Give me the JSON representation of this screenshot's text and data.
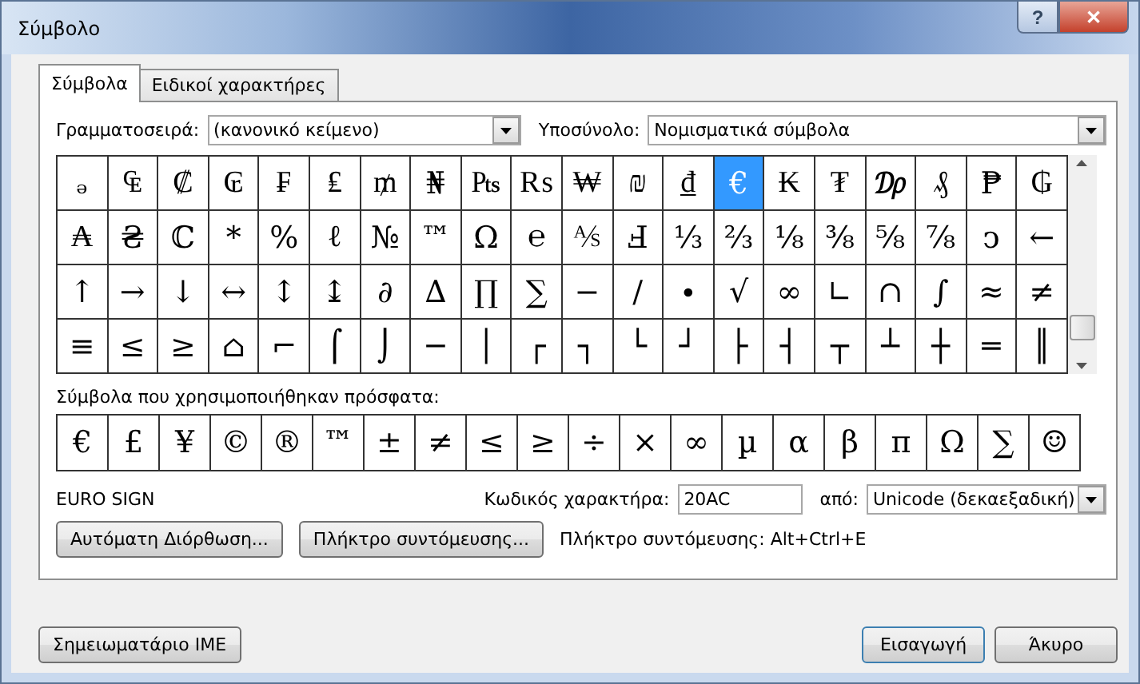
{
  "window": {
    "title": "Σύμβολο",
    "buttons": [
      "?",
      "✕"
    ]
  },
  "tabs": [
    {
      "label": "Σύμβολα",
      "selected": true
    },
    {
      "label": "Ειδικοί χαρακτήρες",
      "selected": false
    }
  ],
  "font": {
    "label": "Γραμματοσειρά:",
    "value": "(κανονικό κείμενο)"
  },
  "subset": {
    "label": "Υποσύνολο:",
    "value": "Νομισματικά σύμβολα"
  },
  "grid": [
    [
      {
        "char": "ₔ",
        "selected": false
      },
      {
        "char": "₠",
        "selected": false
      },
      {
        "char": "₡",
        "selected": false
      },
      {
        "char": "₢",
        "selected": false
      },
      {
        "char": "₣",
        "selected": false
      },
      {
        "char": "₤",
        "selected": false
      },
      {
        "char": "₥",
        "selected": false
      },
      {
        "char": "₦",
        "selected": false
      },
      {
        "char": "₧",
        "selected": false
      },
      {
        "char": "₨",
        "selected": false
      },
      {
        "char": "₩",
        "selected": false
      },
      {
        "char": "₪",
        "selected": false
      },
      {
        "char": "₫",
        "selected": false
      },
      {
        "char": "€",
        "selected": true
      },
      {
        "char": "₭",
        "selected": false
      },
      {
        "char": "₮",
        "selected": false
      },
      {
        "char": "₯",
        "selected": false
      },
      {
        "char": "₰",
        "selected": false
      },
      {
        "char": "₱",
        "selected": false
      },
      {
        "char": "₲",
        "selected": false
      }
    ],
    [
      {
        "char": "₳",
        "selected": false
      },
      {
        "char": "₴",
        "selected": false
      },
      {
        "char": "ℂ",
        "selected": false
      },
      {
        "char": "*",
        "selected": false
      },
      {
        "char": "%",
        "selected": false
      },
      {
        "char": "ℓ",
        "selected": false
      },
      {
        "char": "№",
        "selected": false
      },
      {
        "char": "™",
        "selected": false
      },
      {
        "char": "Ω",
        "selected": false
      },
      {
        "char": "℮",
        "selected": false
      },
      {
        "char": "⅍",
        "selected": false
      },
      {
        "char": "Ⅎ",
        "selected": false
      },
      {
        "char": "⅓",
        "selected": false
      },
      {
        "char": "⅔",
        "selected": false
      },
      {
        "char": "⅛",
        "selected": false
      },
      {
        "char": "⅜",
        "selected": false
      },
      {
        "char": "⅝",
        "selected": false
      },
      {
        "char": "⅞",
        "selected": false
      },
      {
        "char": "ↄ",
        "selected": false
      },
      {
        "char": "←",
        "selected": false
      }
    ],
    [
      {
        "char": "↑",
        "selected": false
      },
      {
        "char": "→",
        "selected": false
      },
      {
        "char": "↓",
        "selected": false
      },
      {
        "char": "↔",
        "selected": false
      },
      {
        "char": "↕",
        "selected": false
      },
      {
        "char": "↨",
        "selected": false
      },
      {
        "char": "∂",
        "selected": false
      },
      {
        "char": "∆",
        "selected": false
      },
      {
        "char": "∏",
        "selected": false
      },
      {
        "char": "∑",
        "selected": false
      },
      {
        "char": "−",
        "selected": false
      },
      {
        "char": "∕",
        "selected": false
      },
      {
        "char": "∙",
        "selected": false
      },
      {
        "char": "√",
        "selected": false
      },
      {
        "char": "∞",
        "selected": false
      },
      {
        "char": "∟",
        "selected": false
      },
      {
        "char": "∩",
        "selected": false
      },
      {
        "char": "∫",
        "selected": false
      },
      {
        "char": "≈",
        "selected": false
      },
      {
        "char": "≠",
        "selected": false
      }
    ],
    [
      {
        "char": "≡",
        "selected": false
      },
      {
        "char": "≤",
        "selected": false
      },
      {
        "char": "≥",
        "selected": false
      },
      {
        "char": "⌂",
        "selected": false
      },
      {
        "char": "⌐",
        "selected": false
      },
      {
        "char": "⌠",
        "selected": false
      },
      {
        "char": "⌡",
        "selected": false
      },
      {
        "char": "─",
        "selected": false
      },
      {
        "char": "│",
        "selected": false
      },
      {
        "char": "┌",
        "selected": false
      },
      {
        "char": "┐",
        "selected": false
      },
      {
        "char": "└",
        "selected": false
      },
      {
        "char": "┘",
        "selected": false
      },
      {
        "char": "├",
        "selected": false
      },
      {
        "char": "┤",
        "selected": false
      },
      {
        "char": "┬",
        "selected": false
      },
      {
        "char": "┴",
        "selected": false
      },
      {
        "char": "┼",
        "selected": false
      },
      {
        "char": "═",
        "selected": false
      },
      {
        "char": "║",
        "selected": false
      }
    ]
  ],
  "recent": {
    "label": "Σύμβολα που χρησιμοποιήθηκαν πρόσφατα:",
    "chars": [
      "€",
      "£",
      "¥",
      "©",
      "®",
      "™",
      "±",
      "≠",
      "≤",
      "≥",
      "÷",
      "×",
      "∞",
      "µ",
      "α",
      "β",
      "π",
      "Ω",
      "∑",
      "☺"
    ]
  },
  "char_name": "EURO SIGN",
  "char_code": {
    "label": "Κωδικός χαρακτήρα:",
    "value": "20AC"
  },
  "from": {
    "label": "από:",
    "value": "Unicode (δεκαεξαδική)"
  },
  "buttons": [
    "Αυτόματη Διόρθωση...",
    "Πλήκτρο συντόμευσης..."
  ],
  "shortcut_text": "Πλήκτρο συντόμευσης: Alt+Ctrl+E",
  "footer": {
    "ime_button": "Σημειωματάριο IME",
    "insert_button": "Εισαγωγή",
    "cancel_button": "Άκυρο"
  }
}
